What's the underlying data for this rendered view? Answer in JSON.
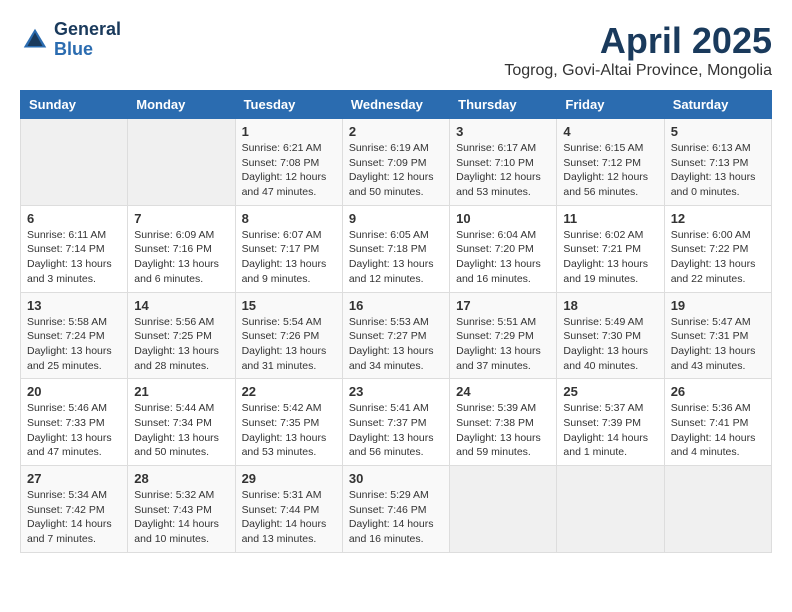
{
  "header": {
    "logo_general": "General",
    "logo_blue": "Blue",
    "title": "April 2025",
    "subtitle": "Togrog, Govi-Altai Province, Mongolia"
  },
  "calendar": {
    "weekdays": [
      "Sunday",
      "Monday",
      "Tuesday",
      "Wednesday",
      "Thursday",
      "Friday",
      "Saturday"
    ],
    "weeks": [
      [
        {
          "day": "",
          "info": ""
        },
        {
          "day": "",
          "info": ""
        },
        {
          "day": "1",
          "info": "Sunrise: 6:21 AM\nSunset: 7:08 PM\nDaylight: 12 hours\nand 47 minutes."
        },
        {
          "day": "2",
          "info": "Sunrise: 6:19 AM\nSunset: 7:09 PM\nDaylight: 12 hours\nand 50 minutes."
        },
        {
          "day": "3",
          "info": "Sunrise: 6:17 AM\nSunset: 7:10 PM\nDaylight: 12 hours\nand 53 minutes."
        },
        {
          "day": "4",
          "info": "Sunrise: 6:15 AM\nSunset: 7:12 PM\nDaylight: 12 hours\nand 56 minutes."
        },
        {
          "day": "5",
          "info": "Sunrise: 6:13 AM\nSunset: 7:13 PM\nDaylight: 13 hours\nand 0 minutes."
        }
      ],
      [
        {
          "day": "6",
          "info": "Sunrise: 6:11 AM\nSunset: 7:14 PM\nDaylight: 13 hours\nand 3 minutes."
        },
        {
          "day": "7",
          "info": "Sunrise: 6:09 AM\nSunset: 7:16 PM\nDaylight: 13 hours\nand 6 minutes."
        },
        {
          "day": "8",
          "info": "Sunrise: 6:07 AM\nSunset: 7:17 PM\nDaylight: 13 hours\nand 9 minutes."
        },
        {
          "day": "9",
          "info": "Sunrise: 6:05 AM\nSunset: 7:18 PM\nDaylight: 13 hours\nand 12 minutes."
        },
        {
          "day": "10",
          "info": "Sunrise: 6:04 AM\nSunset: 7:20 PM\nDaylight: 13 hours\nand 16 minutes."
        },
        {
          "day": "11",
          "info": "Sunrise: 6:02 AM\nSunset: 7:21 PM\nDaylight: 13 hours\nand 19 minutes."
        },
        {
          "day": "12",
          "info": "Sunrise: 6:00 AM\nSunset: 7:22 PM\nDaylight: 13 hours\nand 22 minutes."
        }
      ],
      [
        {
          "day": "13",
          "info": "Sunrise: 5:58 AM\nSunset: 7:24 PM\nDaylight: 13 hours\nand 25 minutes."
        },
        {
          "day": "14",
          "info": "Sunrise: 5:56 AM\nSunset: 7:25 PM\nDaylight: 13 hours\nand 28 minutes."
        },
        {
          "day": "15",
          "info": "Sunrise: 5:54 AM\nSunset: 7:26 PM\nDaylight: 13 hours\nand 31 minutes."
        },
        {
          "day": "16",
          "info": "Sunrise: 5:53 AM\nSunset: 7:27 PM\nDaylight: 13 hours\nand 34 minutes."
        },
        {
          "day": "17",
          "info": "Sunrise: 5:51 AM\nSunset: 7:29 PM\nDaylight: 13 hours\nand 37 minutes."
        },
        {
          "day": "18",
          "info": "Sunrise: 5:49 AM\nSunset: 7:30 PM\nDaylight: 13 hours\nand 40 minutes."
        },
        {
          "day": "19",
          "info": "Sunrise: 5:47 AM\nSunset: 7:31 PM\nDaylight: 13 hours\nand 43 minutes."
        }
      ],
      [
        {
          "day": "20",
          "info": "Sunrise: 5:46 AM\nSunset: 7:33 PM\nDaylight: 13 hours\nand 47 minutes."
        },
        {
          "day": "21",
          "info": "Sunrise: 5:44 AM\nSunset: 7:34 PM\nDaylight: 13 hours\nand 50 minutes."
        },
        {
          "day": "22",
          "info": "Sunrise: 5:42 AM\nSunset: 7:35 PM\nDaylight: 13 hours\nand 53 minutes."
        },
        {
          "day": "23",
          "info": "Sunrise: 5:41 AM\nSunset: 7:37 PM\nDaylight: 13 hours\nand 56 minutes."
        },
        {
          "day": "24",
          "info": "Sunrise: 5:39 AM\nSunset: 7:38 PM\nDaylight: 13 hours\nand 59 minutes."
        },
        {
          "day": "25",
          "info": "Sunrise: 5:37 AM\nSunset: 7:39 PM\nDaylight: 14 hours\nand 1 minute."
        },
        {
          "day": "26",
          "info": "Sunrise: 5:36 AM\nSunset: 7:41 PM\nDaylight: 14 hours\nand 4 minutes."
        }
      ],
      [
        {
          "day": "27",
          "info": "Sunrise: 5:34 AM\nSunset: 7:42 PM\nDaylight: 14 hours\nand 7 minutes."
        },
        {
          "day": "28",
          "info": "Sunrise: 5:32 AM\nSunset: 7:43 PM\nDaylight: 14 hours\nand 10 minutes."
        },
        {
          "day": "29",
          "info": "Sunrise: 5:31 AM\nSunset: 7:44 PM\nDaylight: 14 hours\nand 13 minutes."
        },
        {
          "day": "30",
          "info": "Sunrise: 5:29 AM\nSunset: 7:46 PM\nDaylight: 14 hours\nand 16 minutes."
        },
        {
          "day": "",
          "info": ""
        },
        {
          "day": "",
          "info": ""
        },
        {
          "day": "",
          "info": ""
        }
      ]
    ]
  }
}
